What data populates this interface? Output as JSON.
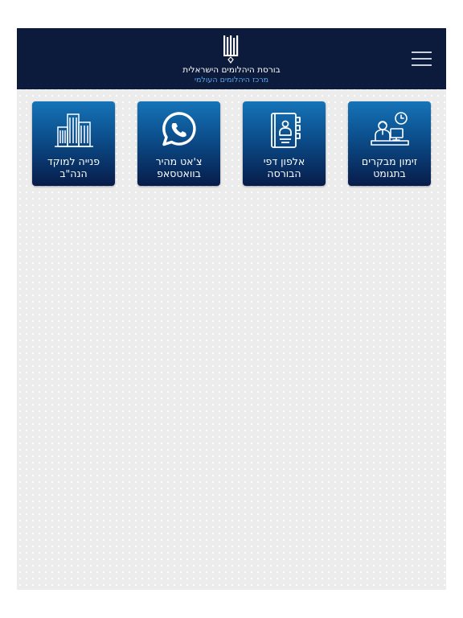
{
  "header": {
    "title": "בורסת היהלומים הישראלית",
    "subtitle": "מרכז היהלומים העולמי",
    "menu_icon": "hamburger-menu-icon",
    "logo_icon": "diamond-exchange-logo-icon"
  },
  "tiles": [
    {
      "line1": "זימון מבקרים",
      "line2": "בתגומט",
      "icon": "visitor-desk-clock-icon"
    },
    {
      "line1": "אלפון דפי",
      "line2": "הבורסה",
      "icon": "address-book-icon"
    },
    {
      "line1": "צ'אט מהיר",
      "line2": "בוואטסאפ",
      "icon": "whatsapp-icon"
    },
    {
      "line1": "פנייה למוקד",
      "line2": "הנה\"ב",
      "icon": "office-buildings-icon"
    }
  ],
  "colors": {
    "header_bg": "#0c1a3c",
    "tile_top": "#1574b8",
    "tile_bottom": "#071c4a",
    "subtitle": "#5aa6ea",
    "page_bg": "#ececec"
  }
}
